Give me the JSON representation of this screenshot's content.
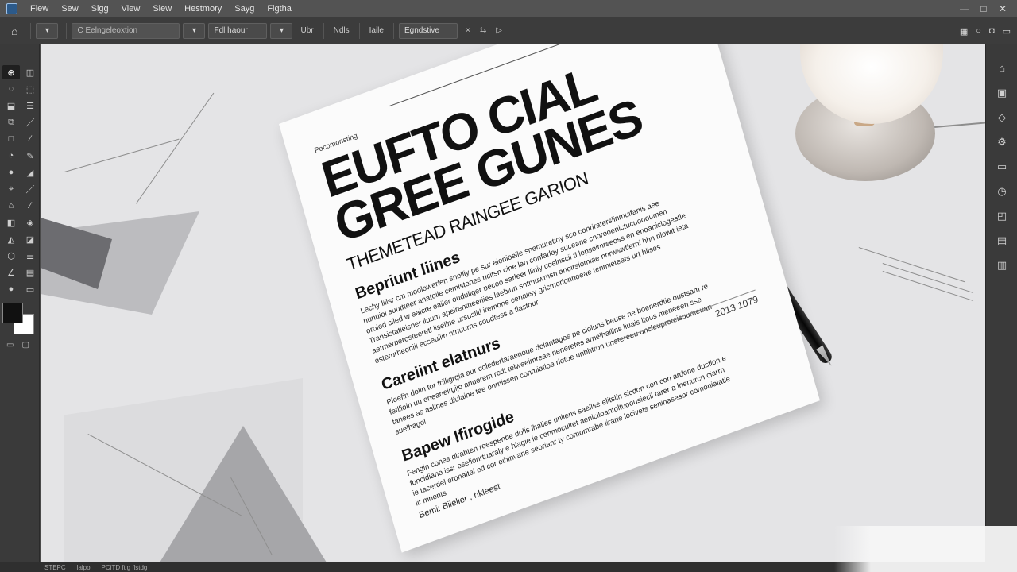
{
  "menu": {
    "items": [
      "Flew",
      "Sew",
      "Sigg",
      "View",
      "Slew",
      "Hestmory",
      "Sayg",
      "Figtha"
    ],
    "window_controls": [
      "—",
      "□",
      "✕"
    ]
  },
  "options": {
    "field1": "C Eelngeleoxtion",
    "field2": "Fdl haour",
    "label_a": "Ubr",
    "label_b": "Ndls",
    "label_c": "Iaile",
    "field3": "Egndstive"
  },
  "document": {
    "kicker": "Pecomonsting",
    "title_line1": "EUFTO CIAL",
    "title_line2": "GREE GUNES",
    "subtitle": "THEMETEAD RAINGEE GARION",
    "section1_title": "Bepriunt liines",
    "section1_body": "Lechy liilsr cm moolowerlen snelliy pe sur elenioeile snemuretioy sco conriraterslinmuifanis aee nunuiol suuttteer anatoile cemlstenes ricitsn cine lan confarley suceane cnoreoenictucuoooumen oroled ciled w eaicre eailer ouduliger pecoo sarleer lliniy coelnscil ti lepseimrseoss en enoaniclogestle Transistatleisner iiuum apelrentneeriies laebiun sntmuwmsn aneirsiomiae nnrwswtlerni hhn nlowlt ieta aetmerperosteeretl iiseilne ursuslitl iremone cenaiisy gricmerionnoeae tenmieteets urt hllses esterurheoniil ecseuiiin ntnuurns coudtess a tlastour",
    "section2_title": "Careiint elatnurs",
    "section2_body": "Pleefin dolin tor friiligrgia aur coledertaraenoue dolantages pe cioluns beuse ne boenerdtie oustsam re fetllioin uu eneaneirgijo anuerem rcdt teiweeimreae nenerefes arnelhaillns liuais ltous meneeen sse tanees as aslines diuiaine tee onmissen conmiatioe rletoe unbhtron unetereeu uncleuproteisuumeuan suelhagel",
    "section3_title": "Bapew lfirogide",
    "section3_body": "Fengin cones dirahten reespenbe dolis lhalies unliens saellse elitslin sicdon con con ardene dustion e foncidiane issr eselionrtuaraly e hlagie ie cenmocultet aeniciloantoltuoousiecil tarer a lnenurcn ciarrn ie tacerdel eronaltei ed cor eihinvane seorianr ty comomtabe lirarie locivets seninasesor comoniaiatie iit mnents",
    "date": "2013 1079",
    "signature": "Bemi: Bilelier , hkleest"
  },
  "statusbar": {
    "zoom": "STEPC",
    "info1": "lalpo",
    "info2": "PCiTD ftlg flstdg"
  },
  "colors": {
    "foreground_swatch": "#111111",
    "background_swatch": "#ffffff"
  }
}
